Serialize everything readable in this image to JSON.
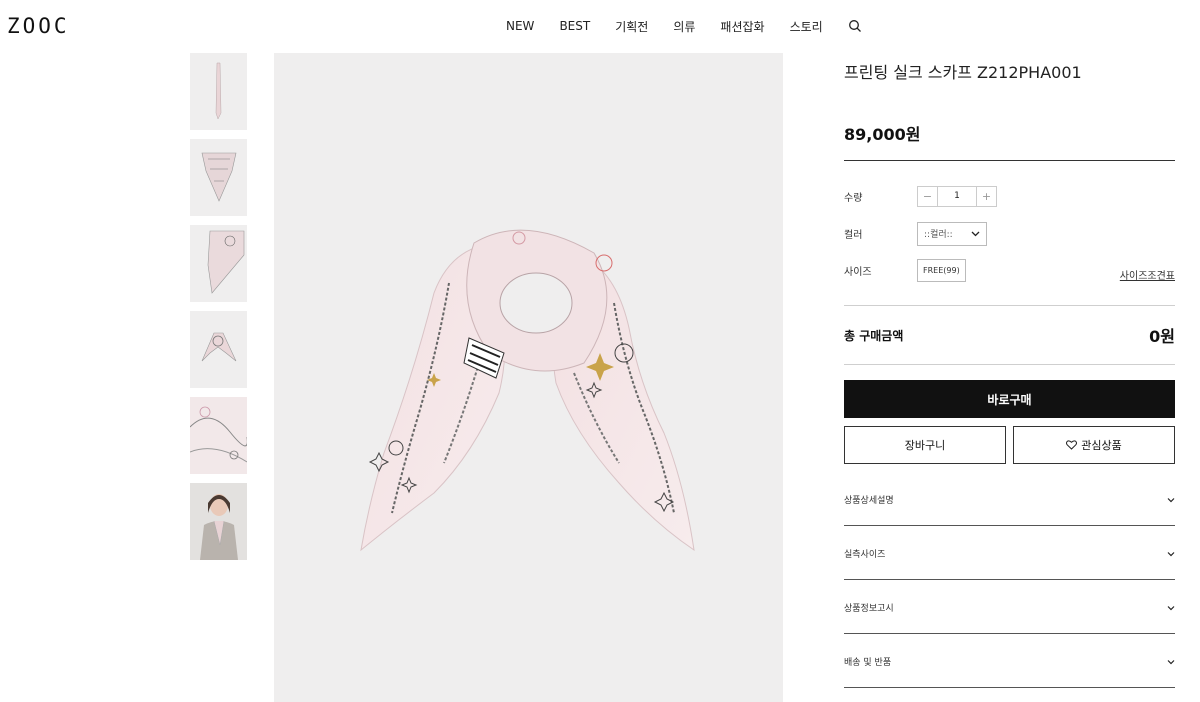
{
  "header": {
    "logo": "ZOOC",
    "nav": [
      "NEW",
      "BEST",
      "기획전",
      "의류",
      "패션잡화",
      "스토리"
    ],
    "search_icon": "search-icon"
  },
  "gallery": {
    "thumbnail_count": 6
  },
  "product": {
    "title": "프린팅 실크 스카프 Z212PHA001",
    "price": "89,000원"
  },
  "options": {
    "qty_label": "수량",
    "qty_value": "1",
    "qty_minus": "−",
    "qty_plus": "+",
    "color_label": "컬러",
    "color_selected": "::컬러::",
    "size_label": "사이즈",
    "size_chip": "FREE(99)",
    "size_guide": "사이즈조견표"
  },
  "total": {
    "label": "총 구매금액",
    "value": "0원"
  },
  "buttons": {
    "buy": "바로구매",
    "cart": "장바구니",
    "wish": "관심상품"
  },
  "accordion": [
    "상품상세설명",
    "실측사이즈",
    "상품정보고시",
    "배송 및 반품"
  ],
  "colors": {
    "accent": "#111111",
    "scarf": "#f2e1e2"
  }
}
